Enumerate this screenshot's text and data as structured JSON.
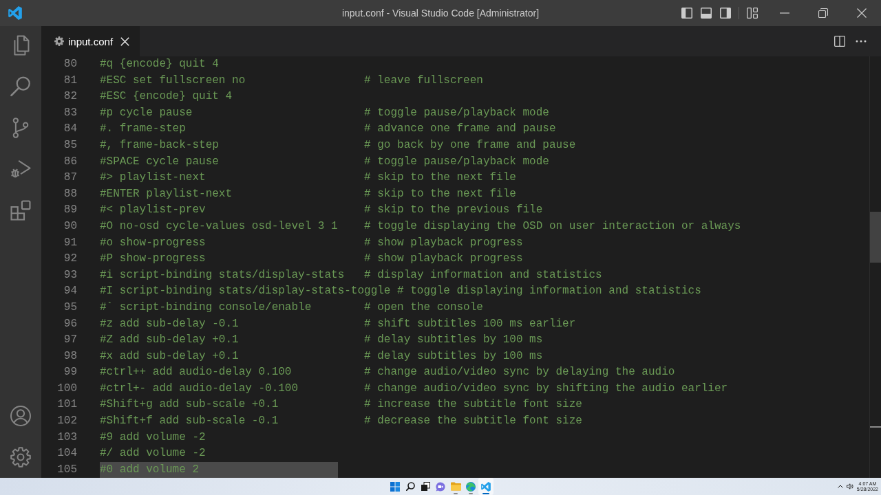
{
  "title_bar": {
    "title": "input.conf - Visual Studio Code [Administrator]"
  },
  "tabs": [
    {
      "label": "input.conf",
      "selected": true
    }
  ],
  "editor": {
    "lines": [
      {
        "number": "80",
        "code": "#q {encode} quit 4",
        "selected": false
      },
      {
        "number": "81",
        "code": "#ESC set fullscreen no",
        "comment": "# leave fullscreen",
        "selected": false
      },
      {
        "number": "82",
        "code": "#ESC {encode} quit 4",
        "selected": false
      },
      {
        "number": "83",
        "code": "#p cycle pause",
        "comment": "# toggle pause/playback mode",
        "selected": false
      },
      {
        "number": "84",
        "code": "#. frame-step",
        "comment": "# advance one frame and pause",
        "selected": false
      },
      {
        "number": "85",
        "code": "#, frame-back-step",
        "comment": "# go back by one frame and pause",
        "selected": false
      },
      {
        "number": "86",
        "code": "#SPACE cycle pause",
        "comment": "# toggle pause/playback mode",
        "selected": false
      },
      {
        "number": "87",
        "code": "#> playlist-next",
        "comment": "# skip to the next file",
        "selected": false
      },
      {
        "number": "88",
        "code": "#ENTER playlist-next",
        "comment": "# skip to the next file",
        "selected": false
      },
      {
        "number": "89",
        "code": "#< playlist-prev",
        "comment": "# skip to the previous file",
        "selected": false
      },
      {
        "number": "90",
        "code": "#O no-osd cycle-values osd-level 3 1",
        "comment": "# toggle displaying the OSD on user interaction or always",
        "selected": false
      },
      {
        "number": "91",
        "code": "#o show-progress",
        "comment": "# show playback progress",
        "selected": false
      },
      {
        "number": "92",
        "code": "#P show-progress",
        "comment": "# show playback progress",
        "selected": false
      },
      {
        "number": "93",
        "code": "#i script-binding stats/display-stats",
        "comment": "# display information and statistics",
        "selected": false
      },
      {
        "number": "94",
        "code": "#I script-binding stats/display-stats-toggle",
        "comment": "# toggle displaying information and statistics",
        "selected": false
      },
      {
        "number": "95",
        "code": "#` script-binding console/enable",
        "comment": "# open the console",
        "selected": false
      },
      {
        "number": "96",
        "code": "#z add sub-delay -0.1",
        "comment": "# shift subtitles 100 ms earlier",
        "selected": false
      },
      {
        "number": "97",
        "code": "#Z add sub-delay +0.1",
        "comment": "# delay subtitles by 100 ms",
        "selected": false
      },
      {
        "number": "98",
        "code": "#x add sub-delay +0.1",
        "comment": "# delay subtitles by 100 ms",
        "selected": false
      },
      {
        "number": "99",
        "code": "#ctrl++ add audio-delay 0.100",
        "comment": "# change audio/video sync by delaying the audio",
        "selected": false
      },
      {
        "number": "100",
        "code": "#ctrl+- add audio-delay -0.100",
        "comment": "# change audio/video sync by shifting the audio earlier",
        "selected": false
      },
      {
        "number": "101",
        "code": "#Shift+g add sub-scale +0.1",
        "comment": "# increase the subtitle font size",
        "selected": false
      },
      {
        "number": "102",
        "code": "#Shift+f add sub-scale -0.1",
        "comment": "# decrease the subtitle font size",
        "selected": false
      },
      {
        "number": "103",
        "code": "#9 add volume -2",
        "selected": false
      },
      {
        "number": "104",
        "code": "#/ add volume -2",
        "selected": false
      },
      {
        "number": "105",
        "code": "#0 add volume 2",
        "selected": true
      }
    ]
  },
  "taskbar": {
    "apps": [
      {
        "running": false,
        "selected": false
      },
      {
        "running": false,
        "selected": false
      },
      {
        "running": false,
        "selected": false
      },
      {
        "running": false,
        "selected": false
      },
      {
        "running": true,
        "selected": false
      },
      {
        "running": true,
        "selected": false
      },
      {
        "running": true,
        "selected": true
      }
    ],
    "time": "4:07 AM",
    "date": "5/28/2022"
  }
}
